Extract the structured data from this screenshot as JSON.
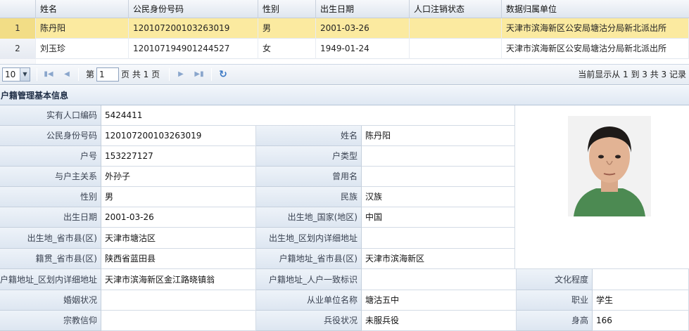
{
  "grid": {
    "columns": [
      "姓名",
      "公民身份号码",
      "性别",
      "出生日期",
      "人口注销状态",
      "数据归属单位"
    ],
    "rows": [
      {
        "num": "1",
        "name": "陈丹阳",
        "id": "120107200103263019",
        "gender": "男",
        "birth": "2001-03-26",
        "status": "",
        "unit": "天津市滨海新区公安局塘沽分局新北派出所"
      },
      {
        "num": "2",
        "name": "刘玉珍",
        "id": "120107194901244527",
        "gender": "女",
        "birth": "1949-01-24",
        "status": "",
        "unit": "天津市滨海新区公安局塘沽分局新北派出所"
      }
    ]
  },
  "pager": {
    "page_size": "10",
    "page_prefix": "第",
    "page_value": "1",
    "page_suffix": "页 共 1 页",
    "info": "当前显示从 1 到 3 共 3 记录"
  },
  "section": {
    "title": "户籍管理基本信息"
  },
  "form": {
    "resident_code_label": "实有人口编码",
    "resident_code": "5424411",
    "id_label": "公民身份号码",
    "id": "120107200103263019",
    "name_label": "姓名",
    "name": "陈丹阳",
    "household_no_label": "户号",
    "household_no": "153227127",
    "household_type_label": "户类型",
    "household_type": "",
    "relation_label": "与户主关系",
    "relation": "外孙子",
    "former_name_label": "曾用名",
    "former_name": "",
    "gender_label": "性别",
    "gender": "男",
    "ethnicity_label": "民族",
    "ethnicity": "汉族",
    "birth_label": "出生日期",
    "birth": "2001-03-26",
    "birth_country_label": "出生地_国家(地区)",
    "birth_country": "中国",
    "birth_province_label": "出生地_省市县(区)",
    "birth_province": "天津市塘沽区",
    "birth_detail_label": "出生地_区划内详细地址",
    "birth_detail": "",
    "native_label": "籍贯_省市县(区)",
    "native": "陕西省蓝田县",
    "reg_province_label": "户籍地址_省市县(区)",
    "reg_province": "天津市滨海新区",
    "reg_detail_label": "户籍地址_区划内详细地址",
    "reg_detail": "天津市滨海新区金江路晓镇翁",
    "reg_consistent_label": "户籍地址_人户一致标识",
    "reg_consistent": "",
    "education_label": "文化程度",
    "education": "",
    "marital_label": "婚姻状况",
    "marital": "",
    "employer_label": "从业单位名称",
    "employer": "塘沽五中",
    "occupation_label": "职业",
    "occupation": "学生",
    "religion_label": "宗教信仰",
    "religion": "",
    "military_label": "兵役状况",
    "military": "未服兵役",
    "height_label": "身高",
    "height": "166"
  }
}
